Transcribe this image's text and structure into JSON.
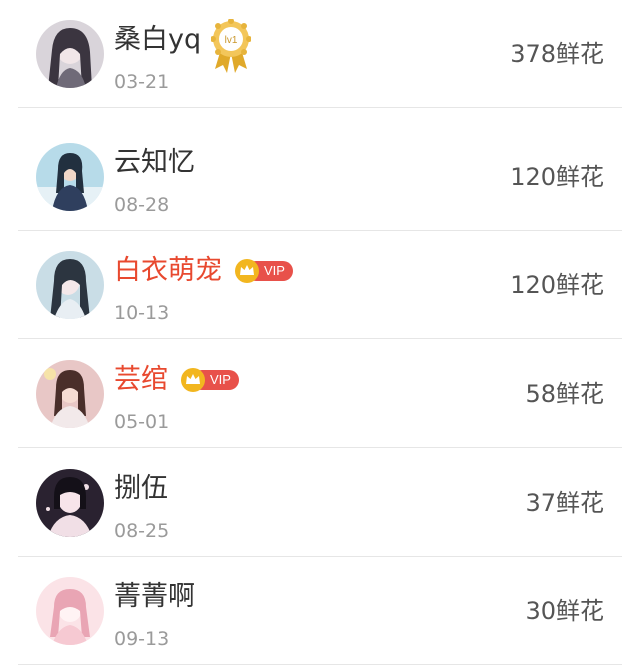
{
  "flower_list": [
    {
      "name": "桑白yq",
      "date": "03-21",
      "flowers": "378鲜花",
      "badge": "level",
      "badge_text": "lv1",
      "name_style": "normal",
      "avatar_bg": "#d9d4da",
      "avatar_fg": "#3b3540"
    },
    {
      "name": "云知忆",
      "date": "08-28",
      "flowers": "120鲜花",
      "badge": "none",
      "badge_text": "",
      "name_style": "normal",
      "avatar_bg": "#b7dbe9",
      "avatar_fg": "#22303f"
    },
    {
      "name": "白衣萌宠",
      "date": "10-13",
      "flowers": "120鲜花",
      "badge": "vip",
      "badge_text": "VIP",
      "name_style": "vip",
      "avatar_bg": "#c9dde6",
      "avatar_fg": "#2c3540"
    },
    {
      "name": "芸绾",
      "date": "05-01",
      "flowers": "58鲜花",
      "badge": "vip",
      "badge_text": "VIP",
      "name_style": "vip",
      "avatar_bg": "#e8c7c6",
      "avatar_fg": "#4a2e2a"
    },
    {
      "name": "捌伍",
      "date": "08-25",
      "flowers": "37鲜花",
      "badge": "none",
      "badge_text": "",
      "name_style": "normal",
      "avatar_bg": "#2a2230",
      "avatar_fg": "#f1dfe6"
    },
    {
      "name": "菁菁啊",
      "date": "09-13",
      "flowers": "30鲜花",
      "badge": "none",
      "badge_text": "",
      "name_style": "normal",
      "avatar_bg": "#fbe3e7",
      "avatar_fg": "#e9a5b4"
    }
  ],
  "colors": {
    "vip_name": "#e8492f",
    "name": "#333333",
    "date": "#9a9a9a",
    "flowers": "#555555",
    "vip_pill": "#e8514a",
    "crown": "#f2b61f",
    "medal": "#e7b43c"
  }
}
